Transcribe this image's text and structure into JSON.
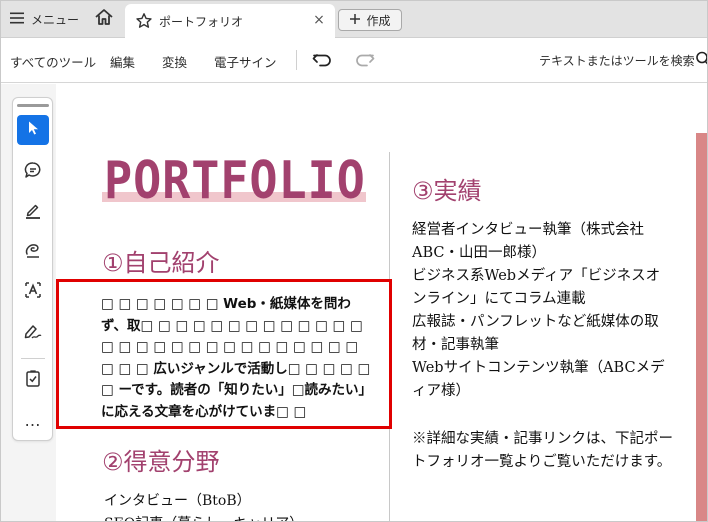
{
  "tabbar": {
    "menu_label": "メニュー",
    "tab_title": "ポートフォリオ",
    "close_glyph": "×",
    "new_label": "作成"
  },
  "toolbar": {
    "items": [
      "すべてのツール",
      "編集",
      "変換",
      "電子サイン"
    ],
    "search_placeholder": "テキストまたはツールを検索"
  },
  "rail": {
    "tools": [
      "select-arrow-icon",
      "comment-icon",
      "highlight-pen-icon",
      "draw-freeform-icon",
      "text-select-icon",
      "sign-pen-icon",
      "checklist-icon"
    ],
    "more_label": "…"
  },
  "document": {
    "title": "PORTFOLIO",
    "left": {
      "intro_heading": "①自己紹介",
      "intro_text": "□ □ □ □ □ □ □ Web・紙媒体を問わず、取□ □ □ □ □ □ □ □ □ □ □ □ □ □ □ □ □ □ □ □ □ □ □ □ □ □ □ □ □ □ □ 広いジャンルで活動し□ □ □ □ □ □ ーです。読者の「知りたい」□読みたい」に応える文章を心がけていま□ □",
      "skills_heading": "②得意分野",
      "skills_line1": "インタビュー（BtoB）",
      "skills_line2": "SEO記事（暮らし・キャリア）"
    },
    "right": {
      "results_heading": "③実績",
      "results_lines": [
        "経営者インタビュー執筆（株式会社ABC・山田一郎様）",
        "ビジネス系Webメディア「ビジネスオンライン」にてコラム連載",
        "広報誌・パンフレットなど紙媒体の取材・記事執筆",
        "Webサイトコンテンツ執筆（ABCメディア様）"
      ],
      "note": "※詳細な実績・記事リンクは、下記ポートフォリオ一覧よりご覧いただけます。"
    }
  },
  "colors": {
    "accent": "#a2416e",
    "highlight": "#f0c6cc",
    "active_tool": "#1473e6",
    "selection_border": "#e00000",
    "side_bar": "#d98787"
  }
}
